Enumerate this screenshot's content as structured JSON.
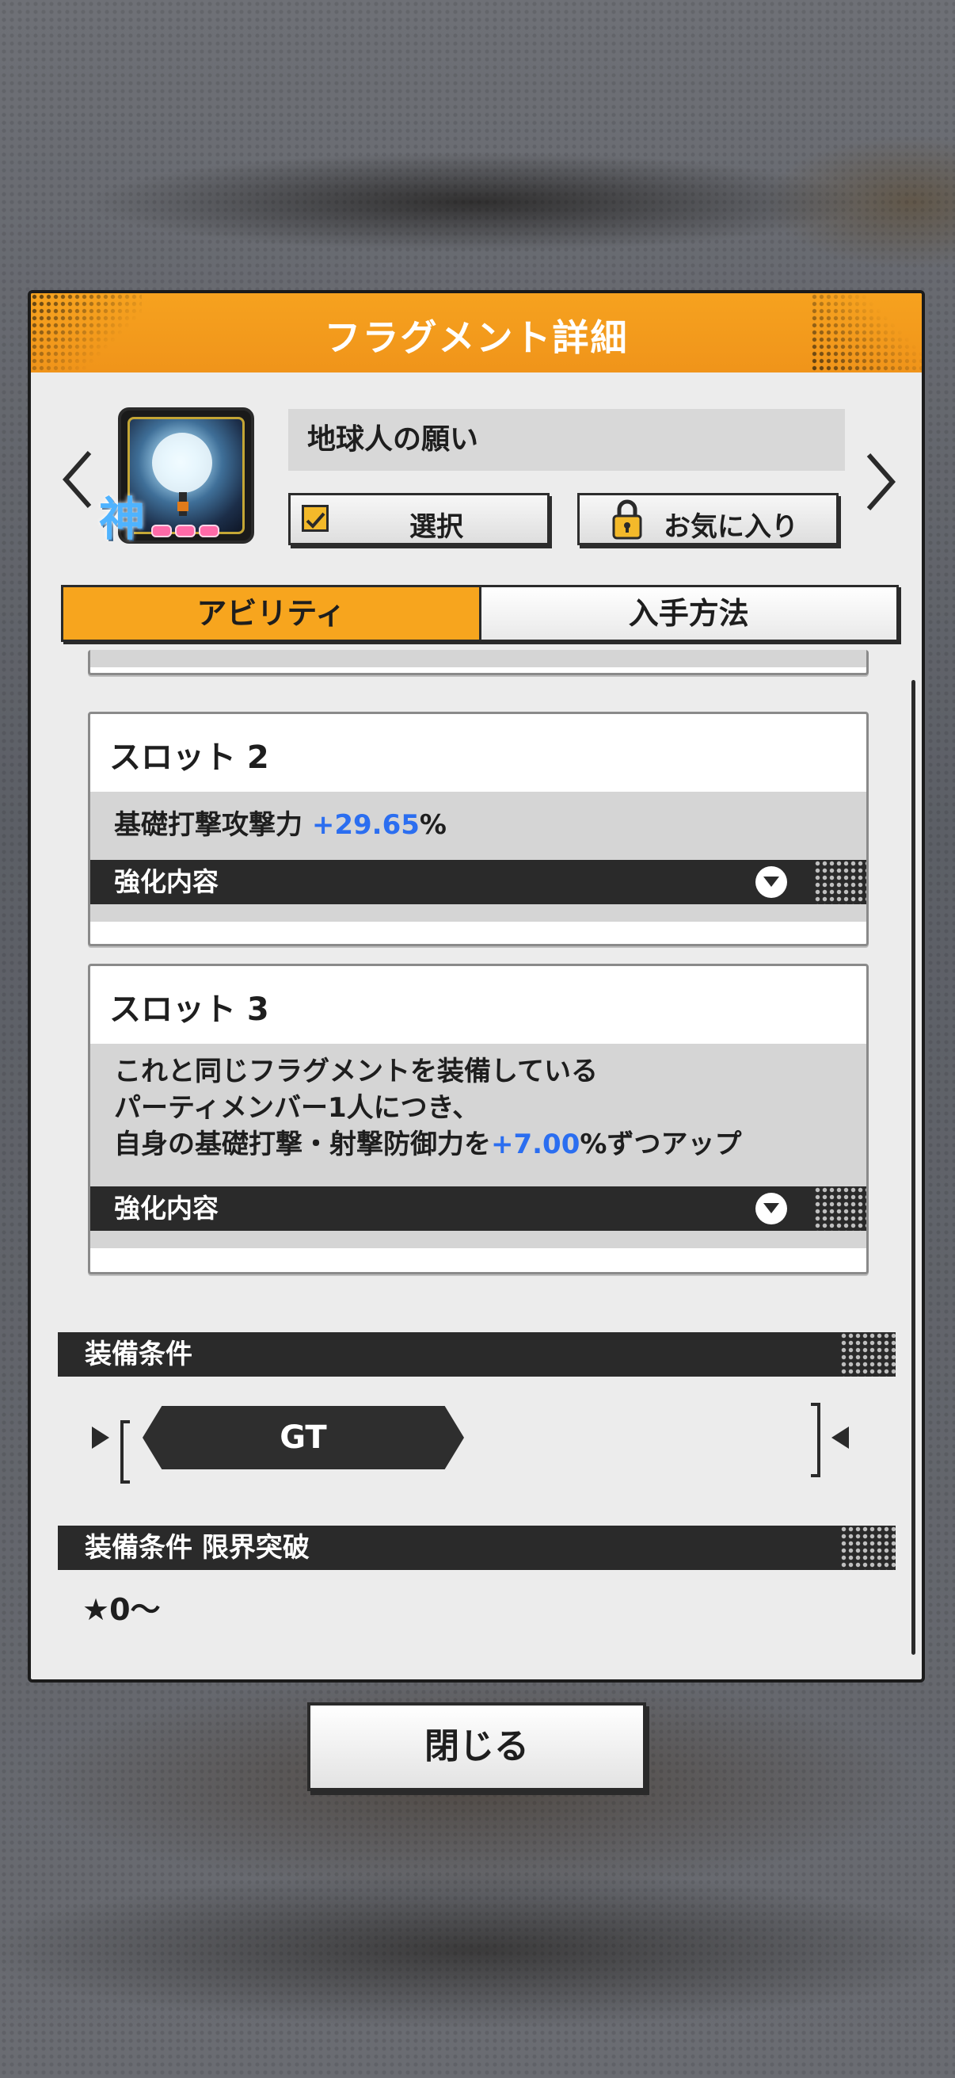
{
  "dialog": {
    "title": "フラグメント詳細",
    "item_name": "地球人の願い",
    "rarity_mark": "神",
    "buttons": {
      "select": "選択",
      "favorite": "お気に入り"
    },
    "tabs": [
      {
        "label": "アビリティ",
        "active": true
      },
      {
        "label": "入手方法",
        "active": false
      }
    ]
  },
  "slots": [
    {
      "title": "スロット 2",
      "desc_prefix": "基礎打撃攻撃力 ",
      "desc_value": "+29.65",
      "desc_suffix": "%",
      "bar_label": "強化内容"
    },
    {
      "title": "スロット 3",
      "line1": "これと同じフラグメントを装備している",
      "line2": "パーティメンバー1人につき、",
      "line3_prefix": "自身の基礎打撃・射撃防御力を",
      "line3_value": "+7.00",
      "line3_suffix": "%ずつアップ",
      "bar_label": "強化内容"
    }
  ],
  "equip": {
    "condition_header": "装備条件",
    "condition_value": "GT",
    "limit_header": "装備条件 限界突破",
    "limit_value": "★0～"
  },
  "footer": {
    "close_label": "閉じる"
  },
  "colors": {
    "accent_orange": "#f7a51e",
    "highlight_blue": "#2b6ef0",
    "dark_bar": "#2a2a2a"
  }
}
